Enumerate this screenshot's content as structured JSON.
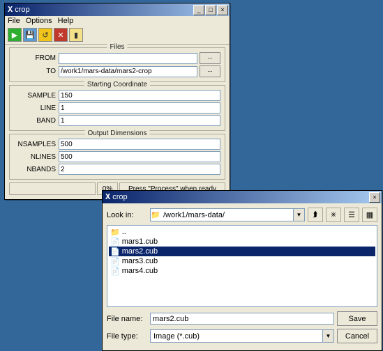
{
  "win1": {
    "title": "crop",
    "menu": {
      "file": "File",
      "options": "Options",
      "help": "Help"
    },
    "sections": {
      "files": {
        "label": "Files",
        "from_label": "FROM",
        "from_value": "",
        "to_label": "TO",
        "to_value": "/work1/mars-data/mars2-crop",
        "browse": "..."
      },
      "start": {
        "label": "Starting Coordinate",
        "sample_label": "SAMPLE",
        "sample_value": "150",
        "line_label": "LINE",
        "line_value": "1",
        "band_label": "BAND",
        "band_value": "1"
      },
      "out": {
        "label": "Output Dimensions",
        "nsamples_label": "NSAMPLES",
        "nsamples_value": "500",
        "nlines_label": "NLINES",
        "nlines_value": "500",
        "nbands_label": "NBANDS",
        "nbands_value": "2"
      }
    },
    "status": {
      "percent": "0%",
      "message": "Press \"Process\" when ready"
    }
  },
  "win2": {
    "title": "crop",
    "lookin_label": "Look in:",
    "lookin_value": "/work1/mars-data/",
    "files": [
      {
        "icon": "folder-up",
        "name": ".."
      },
      {
        "icon": "file",
        "name": "mars1.cub"
      },
      {
        "icon": "file",
        "name": "mars2.cub",
        "selected": true
      },
      {
        "icon": "file",
        "name": "mars3.cub"
      },
      {
        "icon": "file",
        "name": "mars4.cub"
      }
    ],
    "filename_label": "File name:",
    "filename_value": "mars2.cub",
    "filetype_label": "File type:",
    "filetype_value": "Image (*.cub)",
    "save_label": "Save",
    "cancel_label": "Cancel"
  }
}
